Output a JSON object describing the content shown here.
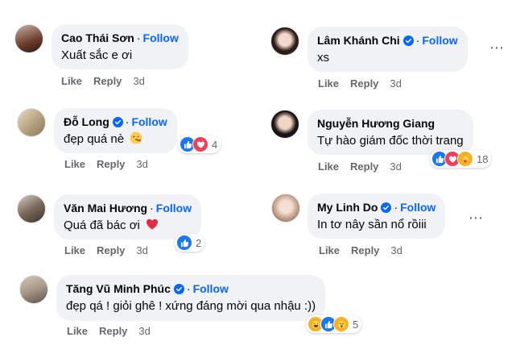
{
  "follow_label": "Follow",
  "like_label": "Like",
  "reply_label": "Reply",
  "more_icon": "⋯",
  "comments": [
    {
      "name": "Cao Thái Sơn",
      "text": "Xuất sắc e ơi",
      "time": "3d",
      "verified": false
    },
    {
      "name": "Lâm Khánh Chi",
      "text": "xs",
      "time": "3d",
      "verified": true
    },
    {
      "name": "Đỗ Long",
      "text": "đẹp quá nè",
      "emoji": "face-blowing-kiss",
      "time": "3d",
      "verified": true,
      "reaction_count": "4"
    },
    {
      "name": "Nguyễn Hương Giang",
      "text": "Tự hào giám đốc thời trang",
      "time": "3d",
      "verified": false,
      "reaction_count": "18"
    },
    {
      "name": "Văn Mai Hương",
      "text": "Quá đã bác ơi",
      "emoji": "red-heart",
      "time": "3d",
      "verified": false,
      "reaction_count": "2"
    },
    {
      "name": "My Linh Do",
      "text": "In tơ nây sần nổ rồiii",
      "time": "3d",
      "verified": true
    },
    {
      "name": "Tăng Vũ Minh Phúc",
      "text": "đẹp qá ! giỏi ghê ! xứng đáng mời qua nhậu :))",
      "time": "3d",
      "verified": true,
      "reaction_count": "5"
    }
  ],
  "colors": {
    "follow": "#0866ff",
    "like": "#1877f2",
    "love": "#f33e58",
    "care": "#f7b125",
    "bubble": "#f0f2f5",
    "meta": "#65676b"
  }
}
